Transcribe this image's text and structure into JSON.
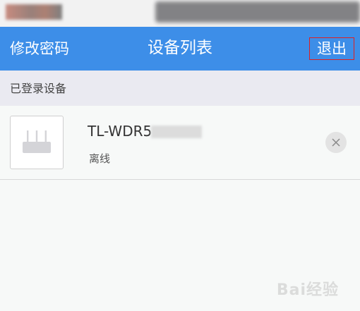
{
  "nav": {
    "left_label": "修改密码",
    "title": "设备列表",
    "right_label": "退出"
  },
  "section": {
    "header": "已登录设备"
  },
  "devices": [
    {
      "name": "TL-WDR5",
      "status": "离线",
      "icon": "router-icon"
    }
  ],
  "watermark": "Bai经验",
  "colors": {
    "nav_bg": "#3d8ee8",
    "section_bg": "#eaeaf1",
    "page_bg": "#f7f9f8",
    "highlight_border": "#e02020"
  }
}
